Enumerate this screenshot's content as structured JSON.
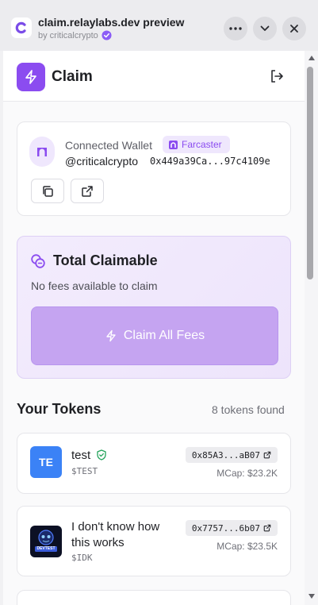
{
  "miniapp": {
    "title": "claim.relaylabs.dev preview",
    "author": "by criticalcrypto"
  },
  "header": {
    "title": "Claim"
  },
  "wallet": {
    "label": "Connected Wallet",
    "badge": "Farcaster",
    "handle": "@criticalcrypto",
    "address": "0x449a39Ca...97c4109e"
  },
  "claim": {
    "title": "Total Claimable",
    "subtitle": "No fees available to claim",
    "button_label": "Claim All Fees"
  },
  "tokens": {
    "heading": "Your Tokens",
    "count": "8 tokens found",
    "items": [
      {
        "logo_text": "TE",
        "logo_color": "#3b82f6",
        "name": "test",
        "verified": true,
        "symbol": "$TEST",
        "address": "0x85A3...aB07",
        "mcap": "MCap: $23.2K"
      },
      {
        "logo_text": "DEVTEST",
        "logo_color": "#0c1024",
        "name": "I don't know how this works",
        "verified": false,
        "symbol": "$IDK",
        "address": "0x7757...6b07",
        "mcap": "MCap: $23.5K"
      }
    ]
  },
  "colors": {
    "accent": "#8b4cf0",
    "accent_light": "#efe7fd",
    "claim_button": "#c5a4f1",
    "verified_green": "#22a35a"
  }
}
